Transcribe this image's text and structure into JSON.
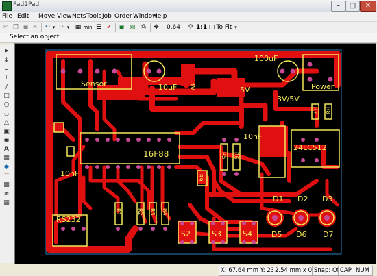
{
  "window": {
    "title": "Pad2Pad"
  },
  "menu": [
    "File",
    "Edit",
    "Move",
    "View",
    "Nets",
    "Tools",
    "Job",
    "Order",
    "Window",
    "Help"
  ],
  "toolbar": {
    "grid_label": "min",
    "zoom_label": "0.64 mm",
    "ratio_label": "1:1",
    "fit_label": "To Fit"
  },
  "status_hint": "Select an object",
  "statusbar": {
    "coords": "X: 67.64 mm Y: 23.72 m",
    "grid": "2.54 mm x 0.64",
    "snap": "Snap: Off",
    "cap": "CAP",
    "num": "NUM"
  },
  "board": {
    "labels": {
      "sensor": "Sensor",
      "cap_100uf": "100uF",
      "cap_10uf": "10uF",
      "reg_3v": "3V",
      "reg_5v": "5V",
      "reg_3v5v": "3V/5V",
      "power": "Power",
      "mcu": "16F88",
      "cap_10nf_left": "10nF",
      "cap_10nf_right": "10nF",
      "eeprom": "24LC512",
      "r5": "R5",
      "r6": "R6",
      "r1": "R1",
      "r2": "R2",
      "r3": "R3",
      "r4": "R4",
      "r7": "R7",
      "r8": "R8",
      "r9": "R9",
      "rs232": "RS232",
      "s2": "S2",
      "s3": "S3",
      "s4": "S4",
      "d1": "D1",
      "d2": "D2",
      "d3": "D3",
      "d5": "D5",
      "d6": "D6",
      "d7": "D7"
    },
    "colors": {
      "board_bg": "#000000",
      "copper": "#e01010",
      "silkscreen": "#f2e85a",
      "pad": "#c84a96"
    }
  }
}
